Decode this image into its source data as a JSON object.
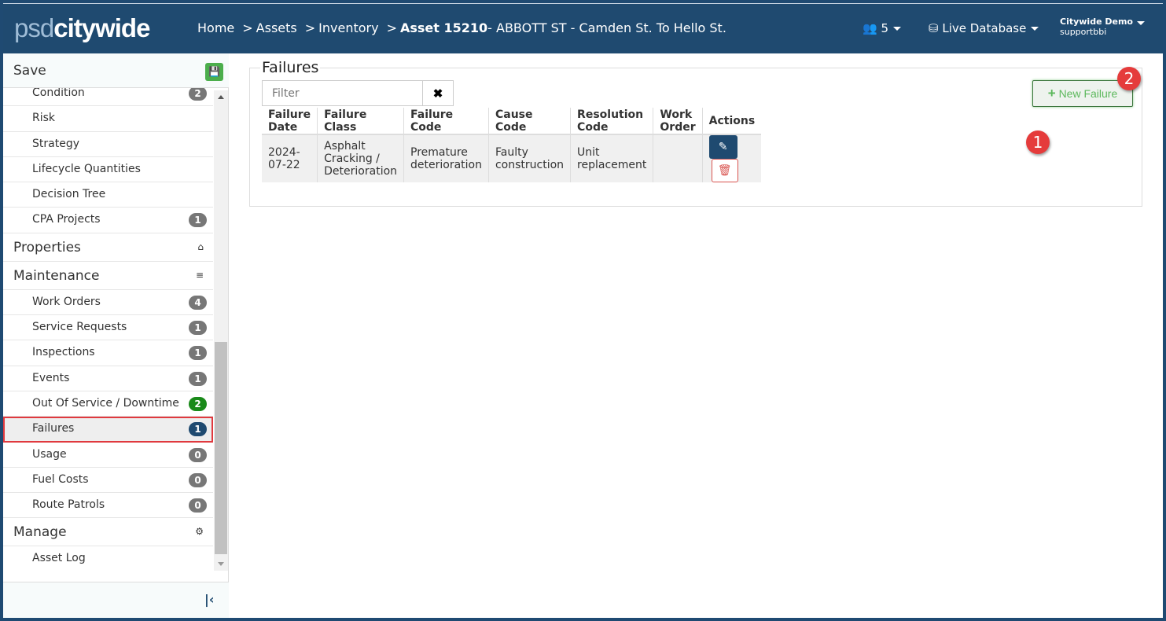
{
  "header": {
    "logo_light": "psd",
    "logo_bold": "citywide",
    "breadcrumbs": [
      "Home",
      ">",
      "Assets",
      ">",
      "Inventory",
      ">"
    ],
    "asset_label": "Asset 15210",
    "asset_desc": "- ABBOTT ST - Camden St. To Hello St.",
    "users_count": "5",
    "database": "Live Database",
    "user_name": "Citywide Demo",
    "user_login": "supportbbi"
  },
  "sidebar": {
    "save_label": "Save",
    "items": [
      {
        "type": "item",
        "label": "Condition",
        "badge": "2"
      },
      {
        "type": "item",
        "label": "Risk"
      },
      {
        "type": "item",
        "label": "Strategy"
      },
      {
        "type": "item",
        "label": "Lifecycle Quantities"
      },
      {
        "type": "item",
        "label": "Decision Tree"
      },
      {
        "type": "item",
        "label": "CPA Projects",
        "badge": "1"
      },
      {
        "type": "section",
        "label": "Properties",
        "icon": "home-icon"
      },
      {
        "type": "section",
        "label": "Maintenance",
        "icon": "road-icon"
      },
      {
        "type": "item",
        "label": "Work Orders",
        "badge": "4"
      },
      {
        "type": "item",
        "label": "Service Requests",
        "badge": "1"
      },
      {
        "type": "item",
        "label": "Inspections",
        "badge": "1"
      },
      {
        "type": "item",
        "label": "Events",
        "badge": "1"
      },
      {
        "type": "item",
        "label": "Out Of Service / Downtime",
        "badge": "2",
        "badge_color": "#1a8a1a"
      },
      {
        "type": "item",
        "label": "Failures",
        "badge": "1",
        "badge_color": "#1f4a70",
        "active": true
      },
      {
        "type": "item",
        "label": "Usage",
        "badge": "0"
      },
      {
        "type": "item",
        "label": "Fuel Costs",
        "badge": "0"
      },
      {
        "type": "item",
        "label": "Route Patrols",
        "badge": "0"
      },
      {
        "type": "section",
        "label": "Manage",
        "icon": "gear-icon"
      },
      {
        "type": "item",
        "label": "Asset Log"
      }
    ]
  },
  "main": {
    "title": "Failures",
    "filter_placeholder": "Filter",
    "new_button": "New Failure",
    "columns": [
      "Failure Date",
      "Failure Class",
      "Failure Code",
      "Cause Code",
      "Resolution Code",
      "Work Order",
      "Actions"
    ],
    "rows": [
      [
        "2024-07-22",
        "Asphalt Cracking / Deterioration",
        "Premature deterioration",
        "Faulty construction",
        "Unit replacement",
        ""
      ]
    ]
  },
  "markers": [
    "1",
    "2"
  ]
}
